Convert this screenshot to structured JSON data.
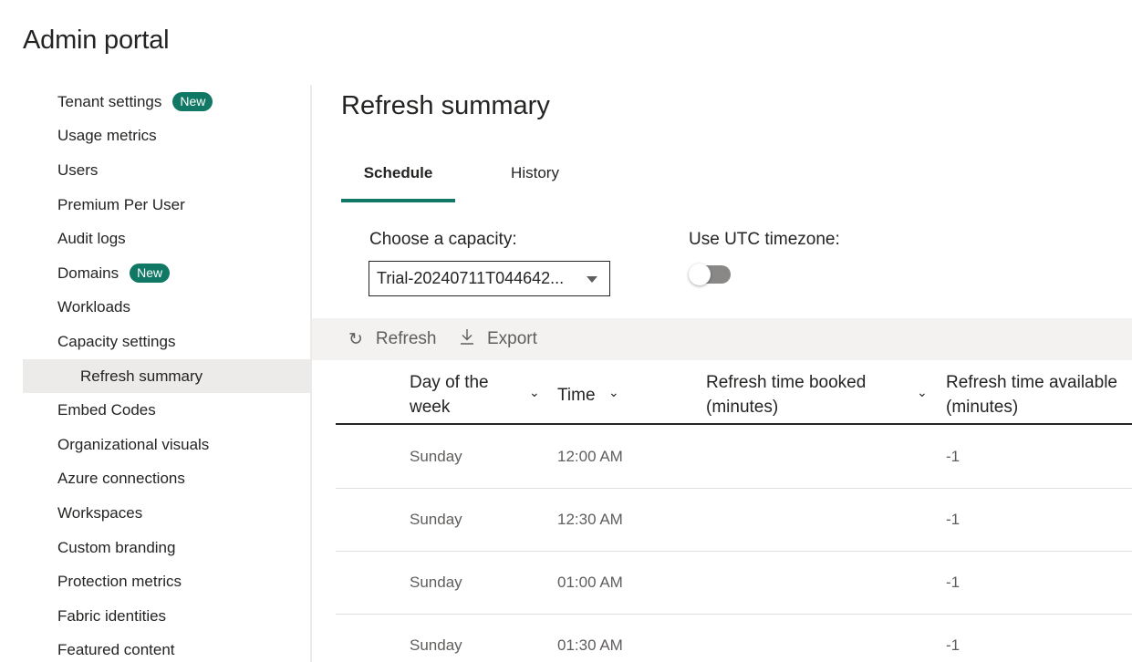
{
  "page_title": "Admin portal",
  "sidebar": {
    "items": [
      {
        "label": "Tenant settings",
        "badge": "New"
      },
      {
        "label": "Usage metrics"
      },
      {
        "label": "Users"
      },
      {
        "label": "Premium Per User"
      },
      {
        "label": "Audit logs"
      },
      {
        "label": "Domains",
        "badge": "New"
      },
      {
        "label": "Workloads"
      },
      {
        "label": "Capacity settings"
      },
      {
        "label": "Refresh summary",
        "active": true,
        "sub": true
      },
      {
        "label": "Embed Codes"
      },
      {
        "label": "Organizational visuals"
      },
      {
        "label": "Azure connections"
      },
      {
        "label": "Workspaces"
      },
      {
        "label": "Custom branding"
      },
      {
        "label": "Protection metrics"
      },
      {
        "label": "Fabric identities"
      },
      {
        "label": "Featured content"
      }
    ]
  },
  "main": {
    "title": "Refresh summary",
    "tabs": [
      {
        "label": "Schedule",
        "selected": true
      },
      {
        "label": "History",
        "selected": false
      }
    ],
    "capacity_label": "Choose a capacity:",
    "capacity_value": "Trial-20240711T044642...",
    "utc_label": "Use UTC timezone:",
    "utc_toggle_on": false
  },
  "toolbar": {
    "refresh_label": "Refresh",
    "refresh_icon": "refresh-icon",
    "export_label": "Export",
    "export_icon": "download-icon"
  },
  "table": {
    "headers": {
      "day_line1": "Day of the",
      "day_line2": "week",
      "time": "Time",
      "booked_line1": "Refresh time booked",
      "booked_line2": "(minutes)",
      "available_line1": "Refresh time available",
      "available_line2": "(minutes)"
    },
    "rows": [
      {
        "day": "Sunday",
        "time": "12:00 AM",
        "booked": "",
        "available": "-1"
      },
      {
        "day": "Sunday",
        "time": "12:30 AM",
        "booked": "",
        "available": "-1"
      },
      {
        "day": "Sunday",
        "time": "01:00 AM",
        "booked": "",
        "available": "-1"
      },
      {
        "day": "Sunday",
        "time": "01:30 AM",
        "booked": "",
        "available": "-1"
      }
    ]
  },
  "colors": {
    "accent": "#117865",
    "active_bg": "#edebe9",
    "toolbar_bg": "#f3f2f1"
  }
}
